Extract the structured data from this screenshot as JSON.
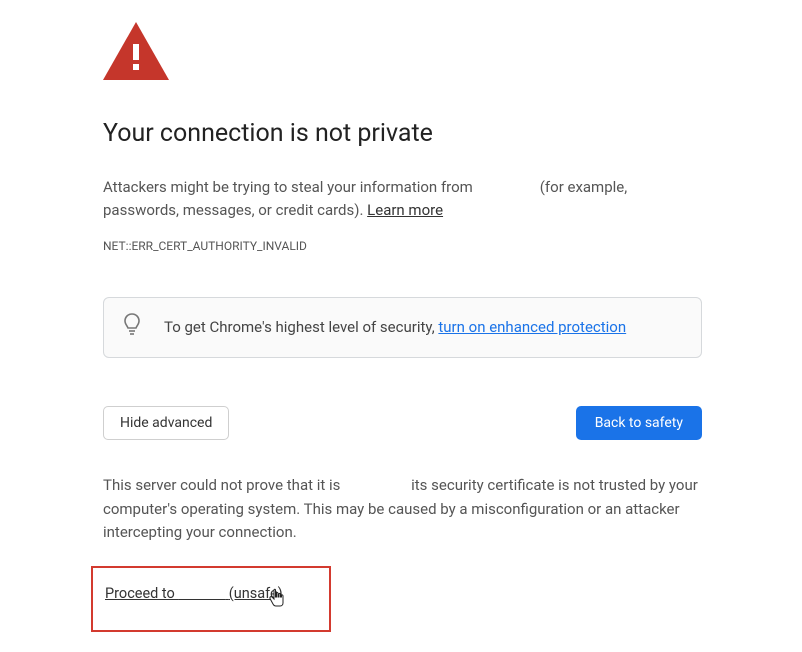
{
  "warning": {
    "title": "Your connection is not private",
    "body_a": "Attackers might be trying to steal your information from ",
    "body_b": " (for example, passwords, messages, or credit cards). ",
    "learn_more": "Learn more",
    "error_code": "NET::ERR_CERT_AUTHORITY_INVALID"
  },
  "tip": {
    "prefix": "To get Chrome's highest level of security, ",
    "link": "turn on enhanced protection"
  },
  "buttons": {
    "hide_advanced": "Hide advanced",
    "back_to_safety": "Back to safety"
  },
  "advanced": {
    "explain_a": "This server could not prove that it is ",
    "explain_b": " its security certificate is not trusted by your computer's operating system. This may be caused by a misconfiguration or an attacker intercepting your connection.",
    "proceed_a": "Proceed to ",
    "proceed_b": " (unsafe)"
  }
}
